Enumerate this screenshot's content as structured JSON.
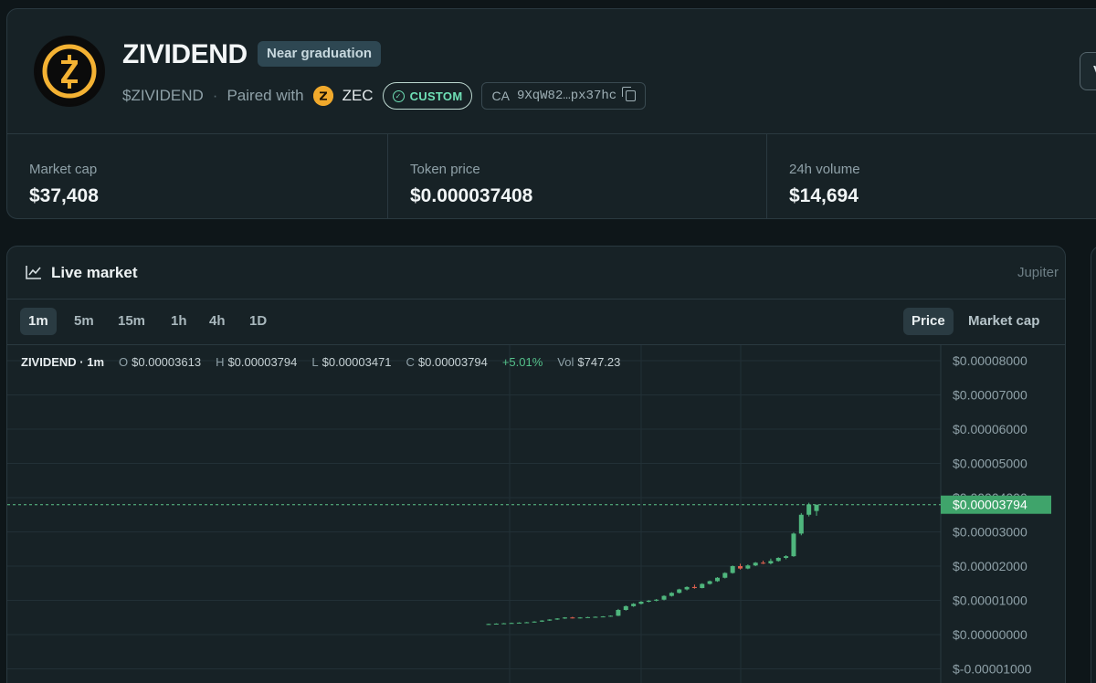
{
  "token": {
    "name": "ZIVIDEND",
    "status_badge": "Near graduation",
    "ticker": "$ZIVIDEND",
    "separator": "·",
    "paired_with_label": "Paired with",
    "pair_symbol": "ZEC",
    "custom_badge": "CUSTOM",
    "ca_label": "CA",
    "ca_value": "9XqW82…px37hc",
    "right_button_label": "V"
  },
  "stats": [
    {
      "label": "Market cap",
      "value": "$37,408"
    },
    {
      "label": "Token price",
      "value": "$0.000037408"
    },
    {
      "label": "24h volume",
      "value": "$14,694"
    }
  ],
  "market": {
    "title": "Live market",
    "source": "Jupiter",
    "timeframes": [
      "1m",
      "5m",
      "15m",
      "1h",
      "4h",
      "1D"
    ],
    "active_timeframe": "1m",
    "modes": [
      "Price",
      "Market cap"
    ],
    "active_mode": "Price",
    "ohlc": {
      "symbol": "ZIVIDEND · 1m",
      "o_label": "O",
      "o_value": "$0.00003613",
      "h_label": "H",
      "h_value": "$0.00003794",
      "l_label": "L",
      "l_value": "$0.00003471",
      "c_label": "C",
      "c_value": "$0.00003794",
      "change": "+5.01%",
      "vol_label": "Vol",
      "vol_value": "$747.23"
    }
  },
  "colors": {
    "up": "#4fb67d",
    "down": "#e0614f",
    "price_line": "#5fc48a",
    "accent_custom": "#6fe0b6"
  },
  "chart_data": {
    "type": "candlestick",
    "y_tick_labels": [
      "$0.00008000",
      "$0.00007000",
      "$0.00006000",
      "$0.00005000",
      "$0.00004000",
      "$0.00003000",
      "$0.00002000",
      "$0.00001000",
      "$0.00000000",
      "$-0.00001000"
    ],
    "ylim": [
      -1e-05,
      8e-05
    ],
    "current_price": 3.794e-05,
    "current_price_label": "$0.00003794",
    "grid": true,
    "candles": [
      {
        "o": 3e-06,
        "h": 3.2e-06,
        "l": 2.9e-06,
        "c": 3.1e-06
      },
      {
        "o": 3.1e-06,
        "h": 3.3e-06,
        "l": 3e-06,
        "c": 3.2e-06
      },
      {
        "o": 3.2e-06,
        "h": 3.4e-06,
        "l": 3.1e-06,
        "c": 3.3e-06
      },
      {
        "o": 3.3e-06,
        "h": 3.5e-06,
        "l": 3.2e-06,
        "c": 3.4e-06
      },
      {
        "o": 3.4e-06,
        "h": 3.6e-06,
        "l": 3.3e-06,
        "c": 3.5e-06
      },
      {
        "o": 3.5e-06,
        "h": 3.7e-06,
        "l": 3.4e-06,
        "c": 3.6e-06
      },
      {
        "o": 3.6e-06,
        "h": 3.9e-06,
        "l": 3.5e-06,
        "c": 3.8e-06
      },
      {
        "o": 3.8e-06,
        "h": 4.2e-06,
        "l": 3.7e-06,
        "c": 4.1e-06
      },
      {
        "o": 4.1e-06,
        "h": 4.5e-06,
        "l": 4e-06,
        "c": 4.4e-06
      },
      {
        "o": 4.4e-06,
        "h": 4.8e-06,
        "l": 4.3e-06,
        "c": 4.7e-06
      },
      {
        "o": 4.7e-06,
        "h": 5.1e-06,
        "l": 4.6e-06,
        "c": 5e-06
      },
      {
        "o": 5e-06,
        "h": 5.2e-06,
        "l": 4.7e-06,
        "c": 4.8e-06
      },
      {
        "o": 4.8e-06,
        "h": 5.1e-06,
        "l": 4.7e-06,
        "c": 5e-06
      },
      {
        "o": 5e-06,
        "h": 5.2e-06,
        "l": 4.9e-06,
        "c": 5.1e-06
      },
      {
        "o": 5.1e-06,
        "h": 5.3e-06,
        "l": 5e-06,
        "c": 5.2e-06
      },
      {
        "o": 5.2e-06,
        "h": 5.4e-06,
        "l": 5.1e-06,
        "c": 5.3e-06
      },
      {
        "o": 5.3e-06,
        "h": 5.6e-06,
        "l": 5.2e-06,
        "c": 5.5e-06
      },
      {
        "o": 5.5e-06,
        "h": 7.5e-06,
        "l": 5.4e-06,
        "c": 7.2e-06
      },
      {
        "o": 7.2e-06,
        "h": 8.5e-06,
        "l": 7e-06,
        "c": 8.3e-06
      },
      {
        "o": 8.3e-06,
        "h": 9.2e-06,
        "l": 8.1e-06,
        "c": 9e-06
      },
      {
        "o": 9e-06,
        "h": 9.8e-06,
        "l": 8.8e-06,
        "c": 9.6e-06
      },
      {
        "o": 9.6e-06,
        "h": 1.01e-05,
        "l": 9.4e-06,
        "c": 9.9e-06
      },
      {
        "o": 9.9e-06,
        "h": 1.04e-05,
        "l": 9.7e-06,
        "c": 1.02e-05
      },
      {
        "o": 1.02e-05,
        "h": 1.15e-05,
        "l": 1e-05,
        "c": 1.13e-05
      },
      {
        "o": 1.13e-05,
        "h": 1.24e-05,
        "l": 1.11e-05,
        "c": 1.22e-05
      },
      {
        "o": 1.22e-05,
        "h": 1.34e-05,
        "l": 1.2e-05,
        "c": 1.32e-05
      },
      {
        "o": 1.32e-05,
        "h": 1.41e-05,
        "l": 1.29e-05,
        "c": 1.39e-05
      },
      {
        "o": 1.39e-05,
        "h": 1.46e-05,
        "l": 1.34e-05,
        "c": 1.36e-05
      },
      {
        "o": 1.36e-05,
        "h": 1.5e-05,
        "l": 1.35e-05,
        "c": 1.48e-05
      },
      {
        "o": 1.48e-05,
        "h": 1.58e-05,
        "l": 1.46e-05,
        "c": 1.56e-05
      },
      {
        "o": 1.56e-05,
        "h": 1.68e-05,
        "l": 1.54e-05,
        "c": 1.66e-05
      },
      {
        "o": 1.66e-05,
        "h": 1.82e-05,
        "l": 1.64e-05,
        "c": 1.8e-05
      },
      {
        "o": 1.8e-05,
        "h": 2.02e-05,
        "l": 1.78e-05,
        "c": 2e-05
      },
      {
        "o": 2e-05,
        "h": 2.07e-05,
        "l": 1.9e-05,
        "c": 1.93e-05
      },
      {
        "o": 1.93e-05,
        "h": 2.05e-05,
        "l": 1.91e-05,
        "c": 2.02e-05
      },
      {
        "o": 2.02e-05,
        "h": 2.12e-05,
        "l": 2e-05,
        "c": 2.1e-05
      },
      {
        "o": 2.1e-05,
        "h": 2.16e-05,
        "l": 2.06e-05,
        "c": 2.08e-05
      },
      {
        "o": 2.08e-05,
        "h": 2.22e-05,
        "l": 2.05e-05,
        "c": 2.15e-05
      },
      {
        "o": 2.15e-05,
        "h": 2.26e-05,
        "l": 2.13e-05,
        "c": 2.24e-05
      },
      {
        "o": 2.24e-05,
        "h": 2.32e-05,
        "l": 2.2e-05,
        "c": 2.29e-05
      },
      {
        "o": 2.29e-05,
        "h": 2.98e-05,
        "l": 2.27e-05,
        "c": 2.95e-05
      },
      {
        "o": 2.95e-05,
        "h": 3.55e-05,
        "l": 2.9e-05,
        "c": 3.5e-05
      },
      {
        "o": 3.5e-05,
        "h": 3.85e-05,
        "l": 3.45e-05,
        "c": 3.8e-05
      },
      {
        "o": 3.61e-05,
        "h": 3.794e-05,
        "l": 3.471e-05,
        "c": 3.794e-05
      }
    ]
  }
}
